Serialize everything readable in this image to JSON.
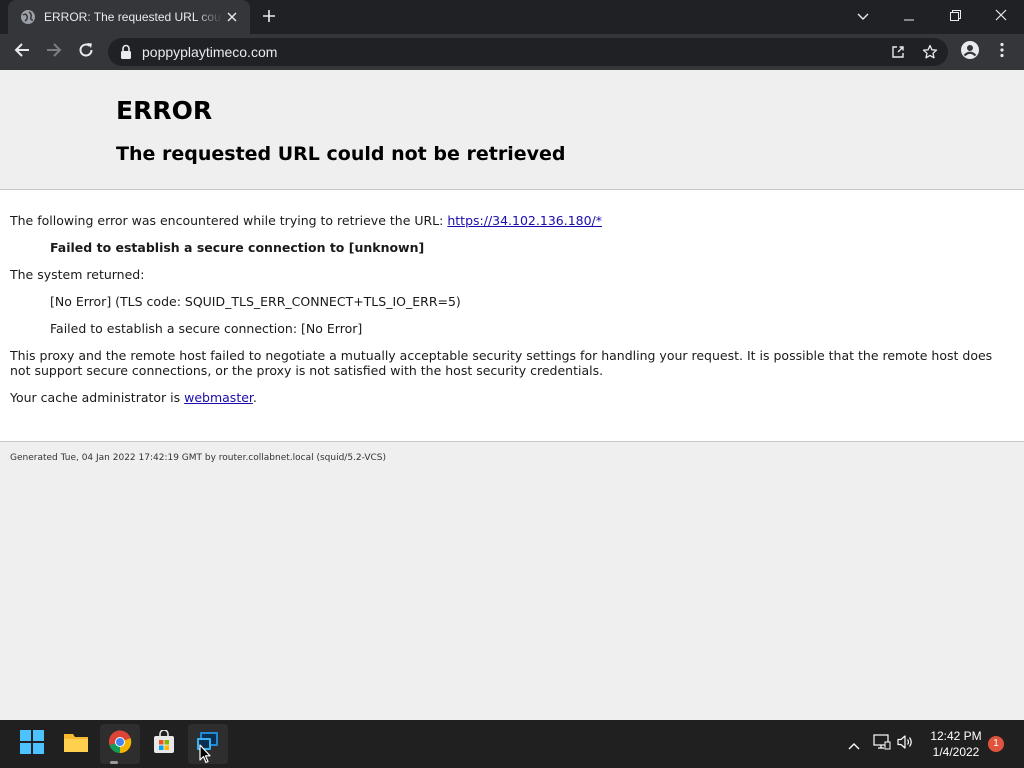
{
  "browser": {
    "tab_title": "ERROR: The requested URL could not be retrieved",
    "url": "poppyplaytimeco.com",
    "tab_favicon": "globe-icon",
    "new_tab_icon": "plus-icon",
    "window_controls": [
      "chevron-down-icon",
      "minimize-icon",
      "restore-icon",
      "close-icon"
    ],
    "toolbar_icons": [
      "back-arrow-icon",
      "forward-arrow-icon",
      "reload-icon",
      "share-icon",
      "star-icon",
      "profile-icon",
      "menu-dots-icon"
    ],
    "colors": {
      "tabstrip": "#202124",
      "toolbar": "#35363a",
      "omnibox": "#202124"
    }
  },
  "page": {
    "error_heading": "ERROR",
    "error_subheading": "The requested URL could not be retrieved",
    "encounter_text": "The following error was encountered while trying to retrieve the URL: ",
    "encounter_url": "https://34.102.136.180/*",
    "failure_line": "Failed to establish a secure connection to [unknown]",
    "system_returned": "The system returned:",
    "tls_code_line": "[No Error] (TLS code: SQUID_TLS_ERR_CONNECT+TLS_IO_ERR=5)",
    "secure_conn_line": "Failed to establish a secure connection: [No Error]",
    "explanation": "This proxy and the remote host failed to negotiate a mutually acceptable security settings for handling your request. It is possible that the remote host does not support secure connections, or the proxy is not satisfied with the host security credentials.",
    "cache_admin_prefix": "Your cache administrator is ",
    "cache_admin_link": "webmaster",
    "cache_admin_suffix": ".",
    "footer": "Generated Tue, 04 Jan 2022 17:42:19 GMT by router.collabnet.local (squid/5.2-VCS)",
    "colors": {
      "link": "#1a0dab",
      "background": "#efefef",
      "content": "#ffffff"
    }
  },
  "taskbar": {
    "items": [
      "windows-start-icon",
      "file-explorer-icon",
      "chrome-icon",
      "store-icon",
      "remote-desktop-icon"
    ],
    "tray_icons": [
      "chevron-up-icon",
      "network-icon",
      "volume-icon"
    ],
    "time": "12:42 PM",
    "date": "1/4/2022",
    "notification_count": "1",
    "colors": {
      "background": "#202020",
      "notification": "#e0533e"
    }
  }
}
